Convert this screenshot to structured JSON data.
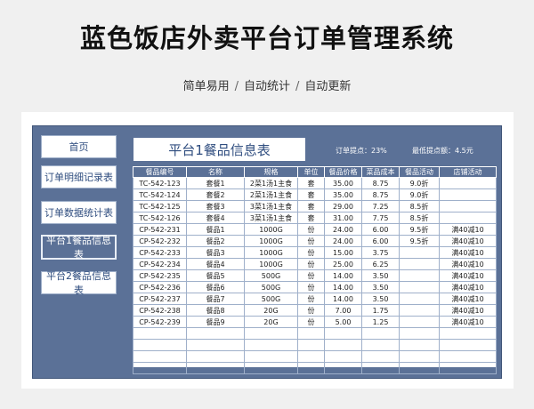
{
  "page": {
    "title": "蓝色饭店外卖平台订单管理系统",
    "subtitle_parts": [
      "简单易用",
      "自动统计",
      "自动更新"
    ],
    "subtitle_sep": "/"
  },
  "nav": {
    "items": [
      {
        "label": "首页"
      },
      {
        "label": "订单明细记录表"
      },
      {
        "label": "订单数据统计表"
      },
      {
        "label": "平台1餐品信息表"
      },
      {
        "label": "平台2餐品信息表"
      }
    ],
    "active_index": 3
  },
  "header": {
    "title": "平台1餐品信息表",
    "commission_label": "订单提点：",
    "commission_value": "23%",
    "min_fee_label": "最低提点额：",
    "min_fee_value": "4.5元"
  },
  "table": {
    "columns": [
      "餐品编号",
      "名称",
      "规格",
      "单位",
      "餐品价格",
      "菜品成本",
      "餐品活动",
      "店铺活动"
    ],
    "rows": [
      [
        "TC-542-123",
        "套餐1",
        "2菜1汤1主食",
        "套",
        "35.00",
        "8.75",
        "9.0折",
        ""
      ],
      [
        "TC-542-124",
        "套餐2",
        "2菜1汤1主食",
        "套",
        "35.00",
        "8.75",
        "9.0折",
        ""
      ],
      [
        "TC-542-125",
        "套餐3",
        "3菜1汤1主食",
        "套",
        "29.00",
        "7.25",
        "8.5折",
        ""
      ],
      [
        "TC-542-126",
        "套餐4",
        "3菜1汤1主食",
        "套",
        "31.00",
        "7.75",
        "8.5折",
        ""
      ],
      [
        "CP-542-231",
        "餐品1",
        "1000G",
        "份",
        "24.00",
        "6.00",
        "9.5折",
        "满40减10"
      ],
      [
        "CP-542-232",
        "餐品2",
        "1000G",
        "份",
        "24.00",
        "6.00",
        "9.5折",
        "满40减10"
      ],
      [
        "CP-542-233",
        "餐品3",
        "1000G",
        "份",
        "15.00",
        "3.75",
        "",
        "满40减10"
      ],
      [
        "CP-542-234",
        "餐品4",
        "1000G",
        "份",
        "25.00",
        "6.25",
        "",
        "满40减10"
      ],
      [
        "CP-542-235",
        "餐品5",
        "500G",
        "份",
        "14.00",
        "3.50",
        "",
        "满40减10"
      ],
      [
        "CP-542-236",
        "餐品6",
        "500G",
        "份",
        "14.00",
        "3.50",
        "",
        "满40减10"
      ],
      [
        "CP-542-237",
        "餐品7",
        "500G",
        "份",
        "14.00",
        "3.50",
        "",
        "满40减10"
      ],
      [
        "CP-542-238",
        "餐品8",
        "20G",
        "份",
        "7.00",
        "1.75",
        "",
        "满40减10"
      ],
      [
        "CP-542-239",
        "餐品9",
        "20G",
        "份",
        "5.00",
        "1.25",
        "",
        "满40减10"
      ]
    ],
    "empty_rows": 4
  },
  "colors": {
    "panel": "#5b7197",
    "frame": "#ffffff",
    "background": "#f0f0f0",
    "accent_text": "#2f4d7f"
  }
}
